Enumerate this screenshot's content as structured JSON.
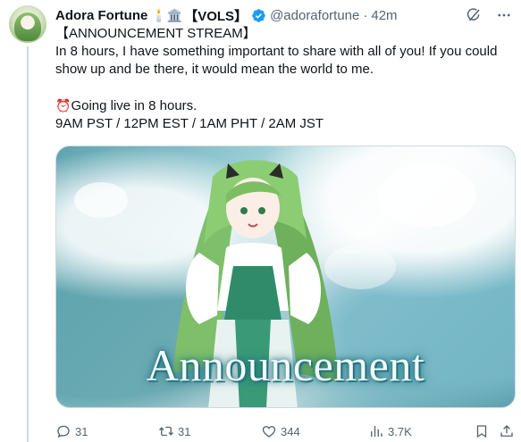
{
  "tweet": {
    "display_name": "Adora Fortune",
    "name_emojis": "🕯️🏛️",
    "name_suffix": "【VOLS】",
    "handle": "@adorafortune",
    "separator": "·",
    "time": "42m",
    "lines": [
      "【ANNOUNCEMENT STREAM】",
      "In 8 hours, I have something important to share with all of you! If you could show up and be there, it would mean the world to me."
    ],
    "alarm_emoji": "⏰",
    "live_line": "Going live in 8 hours.",
    "times_line": "9AM PST / 12PM EST / 1AM PHT / 2AM JST",
    "media_title": "Announcement"
  },
  "actions": {
    "replies": "31",
    "reposts": "31",
    "likes": "344",
    "views": "3.7K"
  },
  "icons": {
    "verified": "verified-badge-icon",
    "grok": "grok-icon",
    "more": "more-icon",
    "reply": "reply-icon",
    "repost": "repost-icon",
    "like": "heart-icon",
    "views": "views-icon",
    "bookmark": "bookmark-icon",
    "share": "share-icon"
  },
  "colors": {
    "verified": "#1d9bf0",
    "text": "#0f1419",
    "secondary": "#536471"
  }
}
